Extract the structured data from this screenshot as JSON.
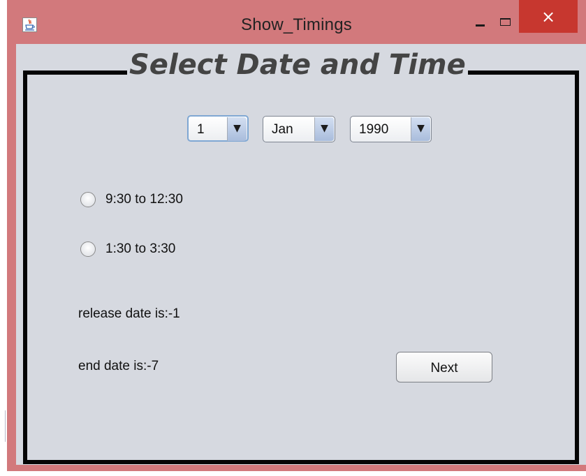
{
  "window": {
    "title": "Show_Timings",
    "minimize_label": "minimize",
    "maximize_label": "maximize",
    "close_glyph": "×",
    "app_icon": "java-cup-icon",
    "colors": {
      "title_bar": "#d2797c",
      "close_button": "#c7372f",
      "content_background": "#d6d9e0"
    }
  },
  "form": {
    "group_title": "Select Date and Time",
    "date": {
      "day": "1",
      "month": "Jan",
      "year": "1990",
      "dropdown_icon": "triangle-down-icon"
    },
    "timings": [
      {
        "label": "9:30 to 12:30",
        "selected": false
      },
      {
        "label": "1:30 to 3:30",
        "selected": false
      }
    ],
    "release_date_text": "release date is:-1",
    "end_date_text": "end date is:-7",
    "next_label": "Next"
  }
}
